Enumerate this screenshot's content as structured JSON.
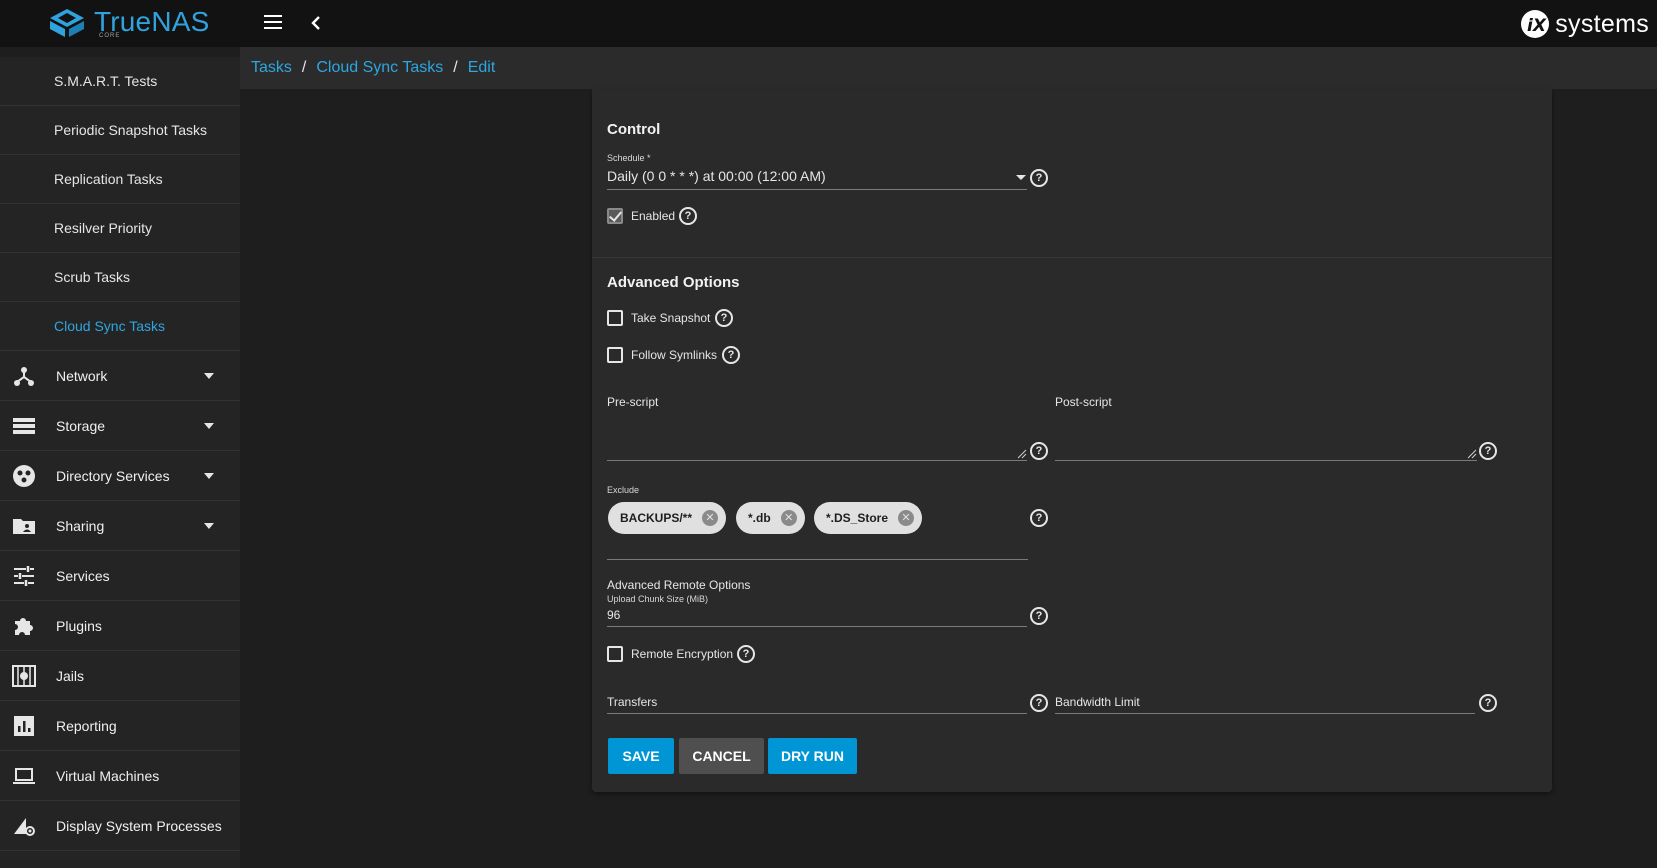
{
  "header": {
    "logo_text": "TrueNAS",
    "logo_sub": "CORE",
    "brand": "systems"
  },
  "sidebar": {
    "sub_items": [
      {
        "label": "S.M.A.R.T. Tests",
        "active": false
      },
      {
        "label": "Periodic Snapshot Tasks",
        "active": false
      },
      {
        "label": "Replication Tasks",
        "active": false
      },
      {
        "label": "Resilver Priority",
        "active": false
      },
      {
        "label": "Scrub Tasks",
        "active": false
      },
      {
        "label": "Cloud Sync Tasks",
        "active": true
      }
    ],
    "main_items": [
      {
        "label": "Network",
        "icon": "network-icon",
        "expandable": true
      },
      {
        "label": "Storage",
        "icon": "storage-icon",
        "expandable": true
      },
      {
        "label": "Directory Services",
        "icon": "directory-services-icon",
        "expandable": true
      },
      {
        "label": "Sharing",
        "icon": "sharing-folder-icon",
        "expandable": true
      },
      {
        "label": "Services",
        "icon": "services-sliders-icon",
        "expandable": false
      },
      {
        "label": "Plugins",
        "icon": "puzzle-icon",
        "expandable": false
      },
      {
        "label": "Jails",
        "icon": "jail-icon",
        "expandable": false
      },
      {
        "label": "Reporting",
        "icon": "reporting-chart-icon",
        "expandable": false
      },
      {
        "label": "Virtual Machines",
        "icon": "laptop-icon",
        "expandable": false
      },
      {
        "label": "Display System Processes",
        "icon": "system-processes-icon",
        "expandable": false
      }
    ]
  },
  "breadcrumb": [
    "Tasks",
    "Cloud Sync Tasks",
    "Edit"
  ],
  "form": {
    "control": {
      "title": "Control",
      "schedule_label": "Schedule *",
      "schedule_value": "Daily (0 0 * * *) at 00:00 (12:00 AM)",
      "enabled_label": "Enabled",
      "enabled_checked": true
    },
    "advanced": {
      "title": "Advanced Options",
      "take_snapshot_label": "Take Snapshot",
      "take_snapshot_checked": false,
      "follow_symlinks_label": "Follow Symlinks",
      "follow_symlinks_checked": false,
      "pre_script_label": "Pre-script",
      "pre_script_value": "",
      "post_script_label": "Post-script",
      "post_script_value": "",
      "exclude_label": "Exclude",
      "exclude_chips": [
        "BACKUPS/**",
        "*.db",
        "*.DS_Store"
      ]
    },
    "remote": {
      "title": "Advanced Remote Options",
      "chunk_label": "Upload Chunk Size (MiB)",
      "chunk_value": "96",
      "remote_encryption_label": "Remote Encryption",
      "remote_encryption_checked": false,
      "transfers_label": "Transfers",
      "bandwidth_label": "Bandwidth Limit"
    },
    "buttons": {
      "save": "SAVE",
      "cancel": "CANCEL",
      "dry_run": "DRY RUN"
    }
  },
  "colors": {
    "accent": "#2ea6e0",
    "save_bg": "#0095d5",
    "cancel_bg": "#4f4f4f",
    "topbar_bg": "#121212"
  }
}
